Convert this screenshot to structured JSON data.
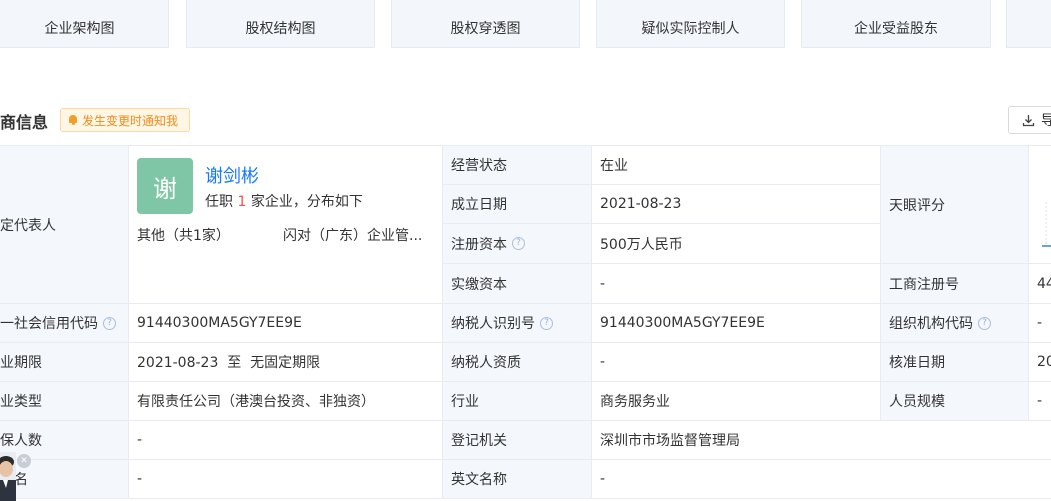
{
  "nav_tabs": [
    "企业架构图",
    "股权结构图",
    "股权穿透图",
    "疑似实际控制人",
    "企业受益股东"
  ],
  "section": {
    "title": "商信息",
    "notify_label": "发生变更时通知我",
    "export_label": "导"
  },
  "legal_rep": {
    "label": "法定代表人",
    "avatar_char": "谢",
    "name": "谢剑彬",
    "sub_prefix": "任职",
    "sub_count": "1",
    "sub_suffix": "家企业，分布如下",
    "chip_other": "其他（共1家）",
    "chip_company": "闪对（广东）企业管..."
  },
  "rows": {
    "status_label": "经营状态",
    "status_value": "在业",
    "founded_label": "成立日期",
    "founded_value": "2021-08-23",
    "capital_label": "注册资本",
    "capital_value": "500万人民币",
    "paid_label": "实缴资本",
    "paid_value": "-",
    "tianyan_label": "天眼评分",
    "regno_label": "工商注册号",
    "regno_value": "44",
    "credit_label": "统一社会信用代码",
    "credit_value": "91440300MA5GY7EE9E",
    "taxid_label": "纳税人识别号",
    "taxid_value": "91440300MA5GY7EE9E",
    "orgcode_label": "组织机构代码",
    "orgcode_value": "-",
    "term_label": "营业期限",
    "term_value": "2021-08-23  至  无固定期限",
    "taxqual_label": "纳税人资质",
    "taxqual_value": "-",
    "approve_label": "核准日期",
    "approve_value": "20",
    "type_label": "企业类型",
    "type_value": "有限责任公司（港澳台投资、非独资）",
    "industry_label": "行业",
    "industry_value": "商务服务业",
    "staff_label": "人员规模",
    "staff_value": "-",
    "insured_label": "参保人数",
    "insured_value": "-",
    "authority_label": "登记机关",
    "authority_value": "深圳市市场监督管理局",
    "formername_label": "曾用名",
    "formername_value": "-",
    "english_label": "英文名称",
    "english_value": "-"
  },
  "colors": {
    "accent": "#1677ff",
    "label_bg": "#f4f7fc",
    "avatar_bg": "#7fc6a6",
    "notify": "#f08c1a"
  }
}
